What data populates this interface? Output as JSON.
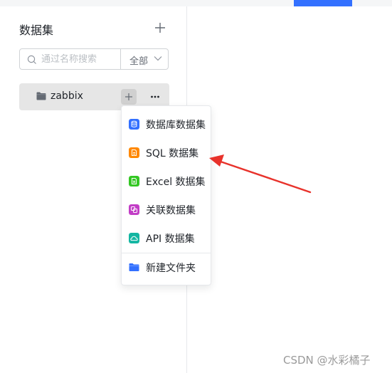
{
  "sidebar": {
    "title": "数据集",
    "search": {
      "placeholder": "通过名称搜索",
      "value": ""
    },
    "filter": {
      "selected": "全部"
    },
    "tree": [
      {
        "label": "zabbix",
        "icon": "folder-icon"
      }
    ]
  },
  "create_menu": {
    "items": [
      {
        "label": "数据库数据集",
        "icon": "database-icon",
        "color": "#3370ff"
      },
      {
        "label": "SQL 数据集",
        "icon": "sql-file-icon",
        "color": "#ff8800"
      },
      {
        "label": "Excel 数据集",
        "icon": "excel-icon",
        "color": "#34c724"
      },
      {
        "label": "关联数据集",
        "icon": "union-icon",
        "color": "#c23ec6"
      },
      {
        "label": "API 数据集",
        "icon": "api-cloud-icon",
        "color": "#14b6a2"
      }
    ],
    "new_folder": {
      "label": "新建文件夹",
      "icon": "folder-icon",
      "color": "#3370ff"
    }
  },
  "annotation": {
    "color": "#e8322b"
  },
  "watermark": {
    "text": "CSDN @水彩橘子"
  },
  "colors": {
    "accent": "#3370ff",
    "selected_row": "#e6e6e6"
  }
}
